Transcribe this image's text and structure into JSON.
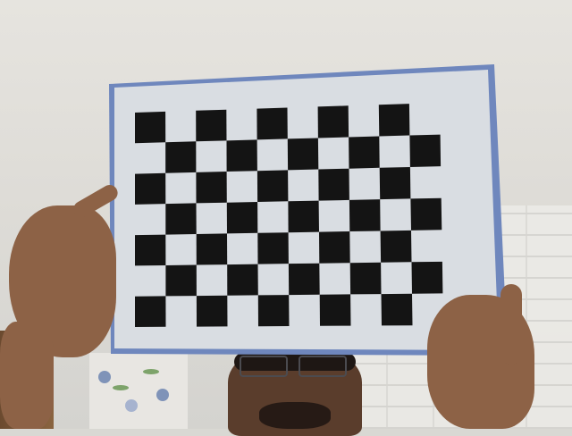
{
  "scene": {
    "description_tags": [
      "calibration-checkerboard",
      "person",
      "hands",
      "ceiling",
      "brick-wall"
    ],
    "checkerboard": {
      "rows": 7,
      "cols": 10,
      "square_color": "#141414",
      "background_color": "#d9dde2",
      "frame_color": "#6f87bd"
    },
    "colors": {
      "skin": "#8d6246",
      "hair": "#1e1714",
      "ceiling": "#e2e0db",
      "wall": "#ecebe7"
    }
  }
}
